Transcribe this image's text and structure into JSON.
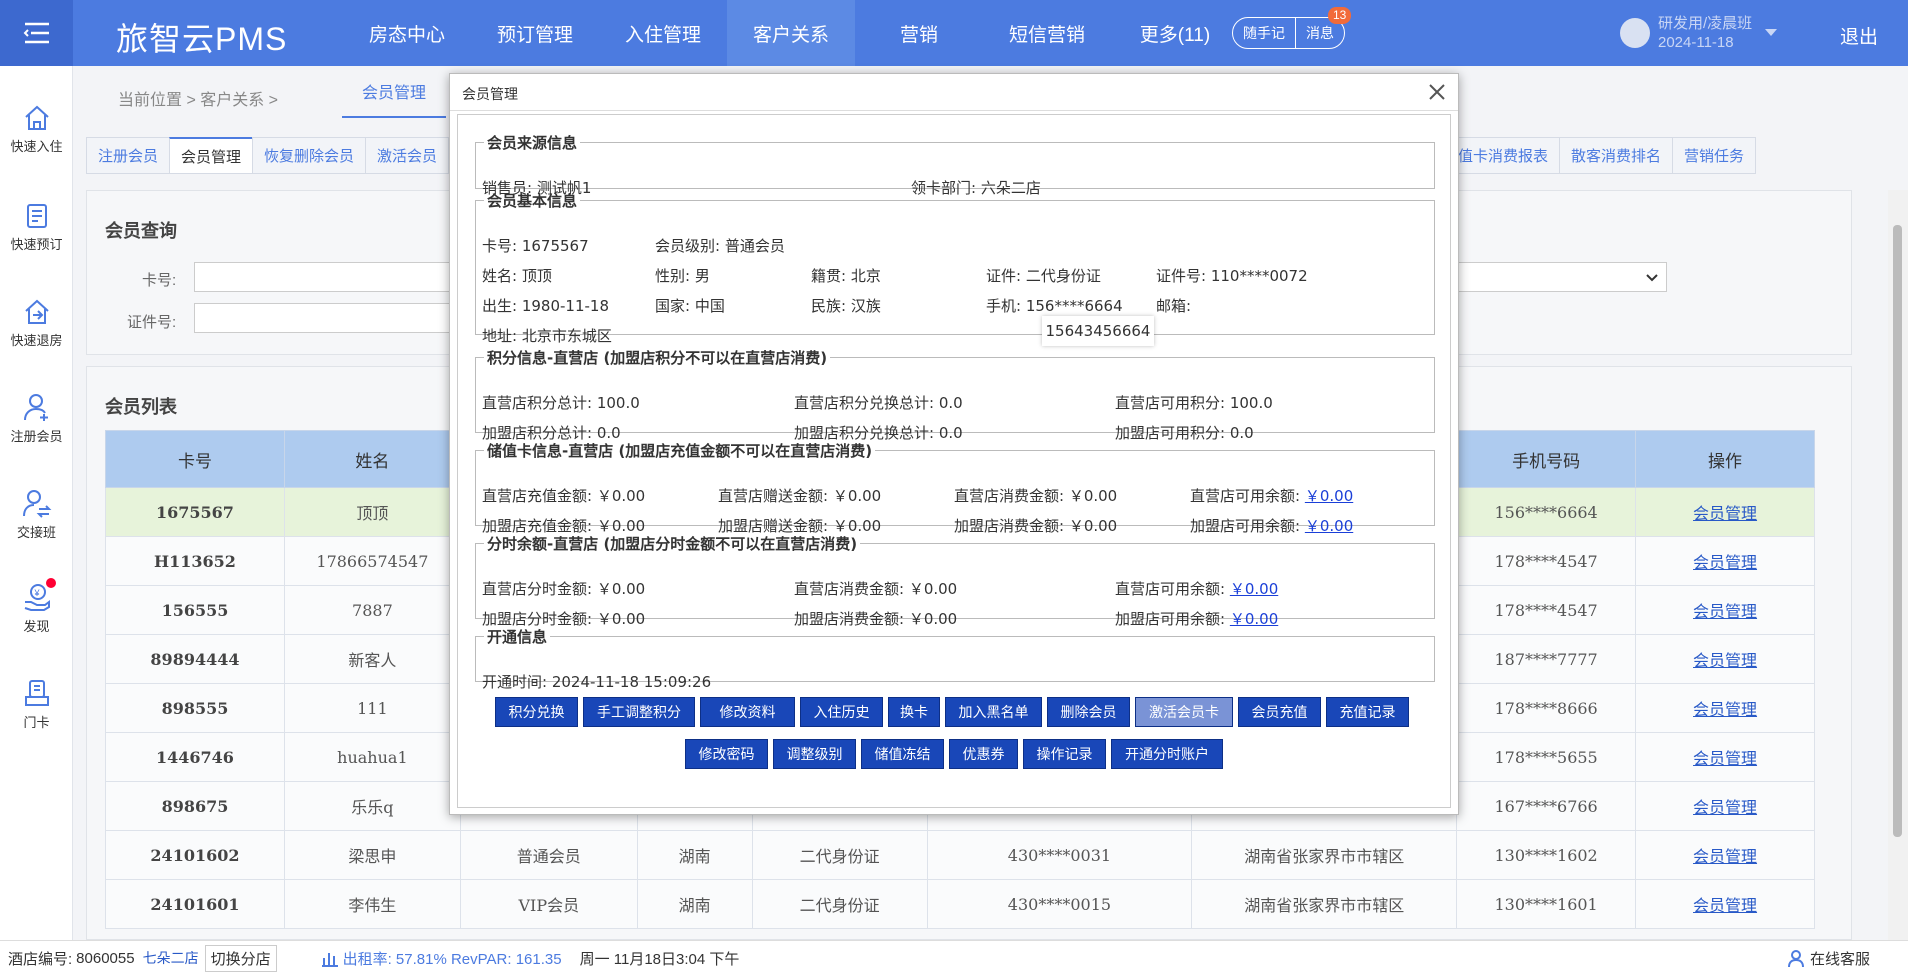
{
  "app": {
    "brand": "旅智云PMS"
  },
  "nav": {
    "items": [
      "房态中心",
      "预订管理",
      "入住管理",
      "客户关系",
      "营销",
      "短信营销",
      "更多(11)"
    ],
    "active_index": 3,
    "memo": "随手记",
    "message": "消息",
    "message_badge": "13"
  },
  "user": {
    "name": "研发用/凌晨班",
    "date": "2024-11-18",
    "logout": "退出"
  },
  "sidebar": [
    {
      "label": "快速入住",
      "icon": "home-icon"
    },
    {
      "label": "快速预订",
      "icon": "booking-list-icon"
    },
    {
      "label": "快速退房",
      "icon": "checkout-icon"
    },
    {
      "label": "注册会员",
      "icon": "user-add-icon"
    },
    {
      "label": "交接班",
      "icon": "shift-handover-icon"
    },
    {
      "label": "发现",
      "icon": "discover-icon"
    },
    {
      "label": "门卡",
      "icon": "door-card-icon"
    }
  ],
  "breadcrumb": {
    "prefix": "当前位置 > 客户关系 >",
    "tab": "会员管理"
  },
  "subtabs": [
    "注册会员",
    "会员管理",
    "恢复删除会员",
    "激活会员"
  ],
  "subtabs_right": [
    "量储值卡消费报表",
    "散客消费排名",
    "营销任务"
  ],
  "query": {
    "title": "会员查询",
    "card_label": "卡号:",
    "id_label": "证件号:"
  },
  "list": {
    "title": "会员列表",
    "headers": [
      "卡号",
      "姓名",
      "",
      "",
      "",
      "",
      "",
      "手机号码",
      "操作"
    ],
    "rows": [
      [
        "1675567",
        "顶顶",
        "",
        "",
        "",
        "",
        "",
        "156****6664",
        "会员管理"
      ],
      [
        "H113652",
        "17866574547",
        "",
        "",
        "",
        "",
        "",
        "178****4547",
        "会员管理"
      ],
      [
        "156555",
        "7887",
        "",
        "",
        "",
        "",
        "",
        "178****4547",
        "会员管理"
      ],
      [
        "89894444",
        "新客人",
        "",
        "",
        "",
        "",
        "",
        "187****7777",
        "会员管理"
      ],
      [
        "898555",
        "111",
        "",
        "",
        "",
        "",
        "",
        "178****8666",
        "会员管理"
      ],
      [
        "1446746",
        "huahua1",
        "",
        "",
        "",
        "",
        "",
        "178****5655",
        "会员管理"
      ],
      [
        "898675",
        "乐乐q",
        "",
        "",
        "",
        "",
        "",
        "167****6766",
        "会员管理"
      ],
      [
        "24101602",
        "梁思申",
        "普通会员",
        "湖南",
        "二代身份证",
        "430****0031",
        "湖南省张家界市市辖区",
        "130****1602",
        "会员管理"
      ],
      [
        "24101601",
        "李伟生",
        "VIP会员",
        "湖南",
        "二代身份证",
        "430****0015",
        "湖南省张家界市市辖区",
        "130****1601",
        "会员管理"
      ]
    ]
  },
  "status": {
    "store_no_label": "酒店编号:",
    "store_no": "8060055",
    "store_name": "七朵二店",
    "switch": "切换分店",
    "occupancy": "出租率: 57.81% RevPAR: 161.35",
    "datetime": "周一 11月18日3:04 下午",
    "service": "在线客服"
  },
  "modal": {
    "title": "会员管理",
    "source": {
      "legend": "会员来源信息",
      "seller": "销售员: 测试帆1",
      "dept": "领卡部门: 六朵二店"
    },
    "basic": {
      "legend": "会员基本信息",
      "card": "卡号: 1675567",
      "level": "会员级别: 普通会员",
      "name": "姓名: 顶顶",
      "gender": "性别: 男",
      "origin": "籍贯: 北京",
      "idtype": "证件: 二代身份证",
      "idno": "证件号: 110****0072",
      "birth": "出生: 1980-11-18",
      "country": "国家: 中国",
      "nation": "民族: 汉族",
      "phone": "手机: 156****6664",
      "email": "邮箱:",
      "address": "地址: 北京市东城区",
      "tooltip": "15643456664"
    },
    "points": {
      "legend": "积分信息-直营店 (加盟店积分不可以在直营店消费)",
      "r1": [
        "直营店积分总计: 100.0",
        "直营店积分兑换总计: 0.0",
        "直营店可用积分: 100.0"
      ],
      "r2": [
        "加盟店积分总计: 0.0",
        "加盟店积分兑换总计: 0.0",
        "加盟店可用积分: 0.0"
      ]
    },
    "stored": {
      "legend": "储值卡信息-直营店 (加盟店充值金额不可以在直营店消费)",
      "r1": [
        "直营店充值金额: ￥0.00",
        "直营店赠送金额: ￥0.00",
        "直营店消费金额: ￥0.00",
        "直营店可用余额:"
      ],
      "r1_link": "￥0.00",
      "r2": [
        "加盟店充值金额: ￥0.00",
        "加盟店赠送金额: ￥0.00",
        "加盟店消费金额: ￥0.00",
        "加盟店可用余额:"
      ],
      "r2_link": "￥0.00"
    },
    "timeshare": {
      "legend": "分时余额-直营店 (加盟店分时金额不可以在直营店消费)",
      "r1": [
        "直营店分时金额: ￥0.00",
        "直营店消费金额: ￥0.00",
        "直营店可用余额:"
      ],
      "r1_link": "￥0.00",
      "r2": [
        "加盟店分时金额: ￥0.00",
        "加盟店消费金额: ￥0.00",
        "加盟店可用余额:"
      ],
      "r2_link": "￥0.00"
    },
    "open": {
      "legend": "开通信息",
      "time": "开通时间: 2024-11-18 15:09:26"
    },
    "buttons_row1": [
      "积分兑换",
      "手工调整积分",
      "修改资料",
      "入住历史",
      "换卡",
      "加入黑名单",
      "删除会员",
      "激活会员卡",
      "会员充值",
      "充值记录"
    ],
    "buttons_row2": [
      "修改密码",
      "调整级别",
      "储值冻结",
      "优惠券",
      "操作记录",
      "开通分时账户"
    ]
  }
}
